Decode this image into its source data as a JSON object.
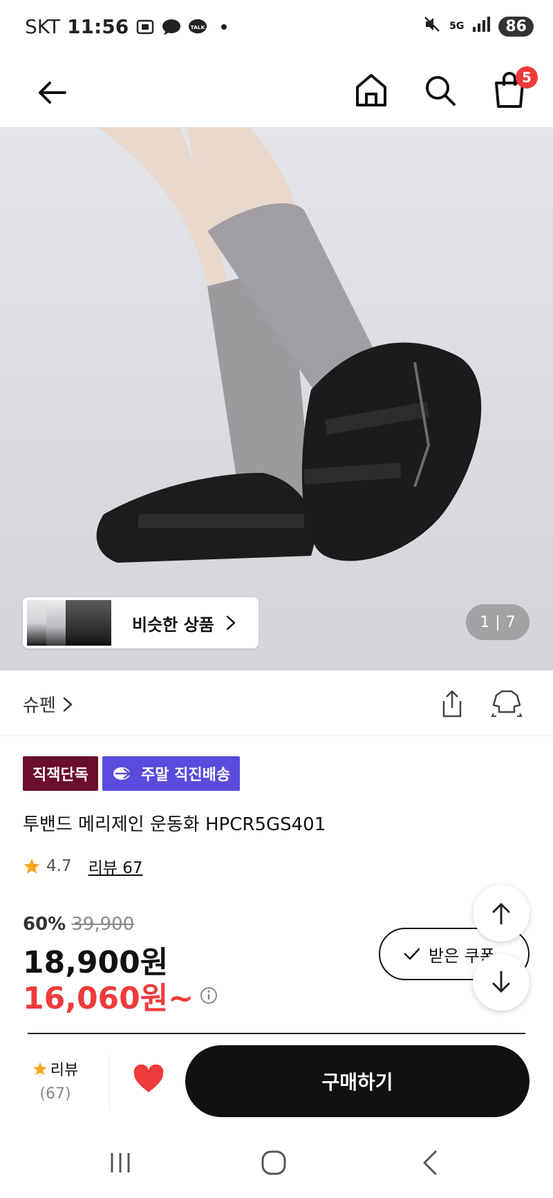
{
  "status_bar": {
    "carrier": "SKT",
    "time": "11:56",
    "network": "5G",
    "battery": "86",
    "icons": [
      "screen-record-icon",
      "chat-bubble-icon",
      "talk-icon",
      "dot-icon",
      "mute-icon",
      "signal-icon"
    ]
  },
  "header": {
    "cart_count": "5",
    "icons": [
      "back-arrow-icon",
      "home-icon",
      "search-icon",
      "shopping-bag-icon"
    ]
  },
  "hero": {
    "similar_label": "비슷한 상품",
    "page_current": "1",
    "page_separator": "|",
    "page_total": "7"
  },
  "brand": {
    "name": "슈펜",
    "icons": [
      "share-icon",
      "fitting-icon"
    ]
  },
  "badges": {
    "exclusive": "직잭단독",
    "weekend": "주말 직진배송"
  },
  "product": {
    "title": "투밴드 메리제인 운동화 HPCR5GS401",
    "rating": "4.7",
    "review_link": "리뷰 67"
  },
  "price": {
    "discount_rate": "60%",
    "original": "39,900",
    "current": "18,900원",
    "sale": "16,060원~",
    "coupon_label": "받은 쿠폰",
    "colors": {
      "sale": "#ee3b3b"
    }
  },
  "action_bar": {
    "review_label": "리뷰",
    "review_count": "(67)",
    "buy_label": "구매하기",
    "colors": {
      "heart": "#ee3b3b",
      "star": "#f5a623"
    }
  },
  "nav_bar": {
    "icons": [
      "recent-apps-icon",
      "home-circle-icon",
      "back-chevron-icon"
    ]
  }
}
